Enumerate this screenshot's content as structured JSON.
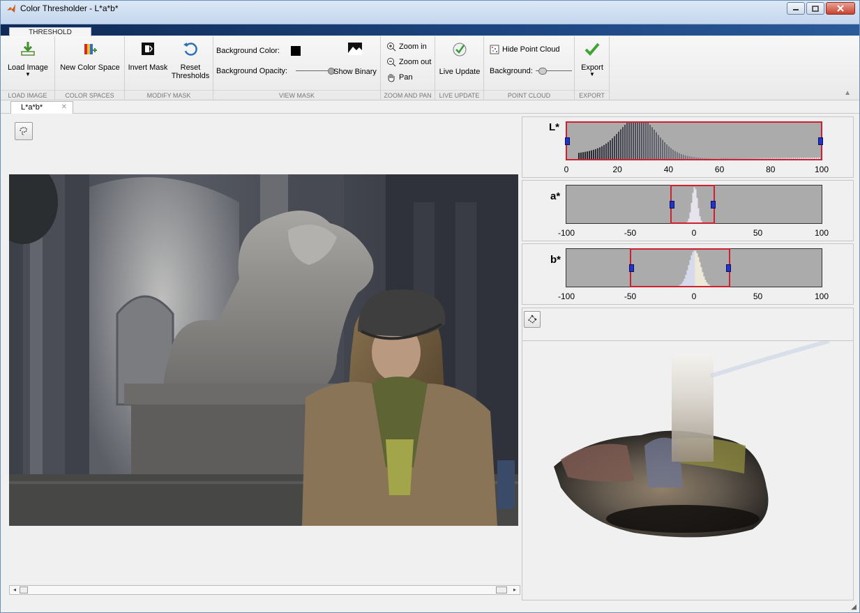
{
  "window": {
    "title": "Color Thresholder - L*a*b*"
  },
  "ribbon": {
    "tab": "THRESHOLD",
    "groups": {
      "load_image": {
        "label": "LOAD IMAGE",
        "button": "Load Image"
      },
      "color_spaces": {
        "label": "COLOR SPACES",
        "button": "New Color Space"
      },
      "modify_mask": {
        "label": "MODIFY MASK",
        "invert": "Invert Mask",
        "reset_line1": "Reset",
        "reset_line2": "Thresholds"
      },
      "view_mask": {
        "label": "VIEW MASK",
        "bg_color": "Background Color:",
        "bg_opacity": "Background Opacity:",
        "show_binary": "Show Binary",
        "bg_color_value": "#000000"
      },
      "zoom_pan": {
        "label": "ZOOM AND PAN",
        "zoom_in": "Zoom in",
        "zoom_out": "Zoom out",
        "pan": "Pan"
      },
      "live_update": {
        "label": "LIVE UPDATE",
        "button": "Live Update"
      },
      "point_cloud": {
        "label": "POINT CLOUD",
        "hide": "Hide Point Cloud",
        "background": "Background:"
      },
      "export": {
        "label": "EXPORT",
        "button": "Export"
      }
    }
  },
  "document_tab": {
    "label": "L*a*b*"
  },
  "histograms": [
    {
      "channel": "L*",
      "ticks": [
        "0",
        "20",
        "40",
        "60",
        "80",
        "100"
      ],
      "range": [
        0,
        100
      ],
      "selection": [
        0,
        100
      ]
    },
    {
      "channel": "a*",
      "ticks": [
        "-100",
        "-50",
        "0",
        "50",
        "100"
      ],
      "range": [
        -100,
        100
      ],
      "selection": [
        -18,
        16
      ]
    },
    {
      "channel": "b*",
      "ticks": [
        "-100",
        "-50",
        "0",
        "50",
        "100"
      ],
      "range": [
        -100,
        100
      ],
      "selection": [
        -50,
        28
      ]
    }
  ],
  "colors": {
    "selection": "#d02030",
    "handle": "#2233c8",
    "plot_bg": "#ababab"
  }
}
